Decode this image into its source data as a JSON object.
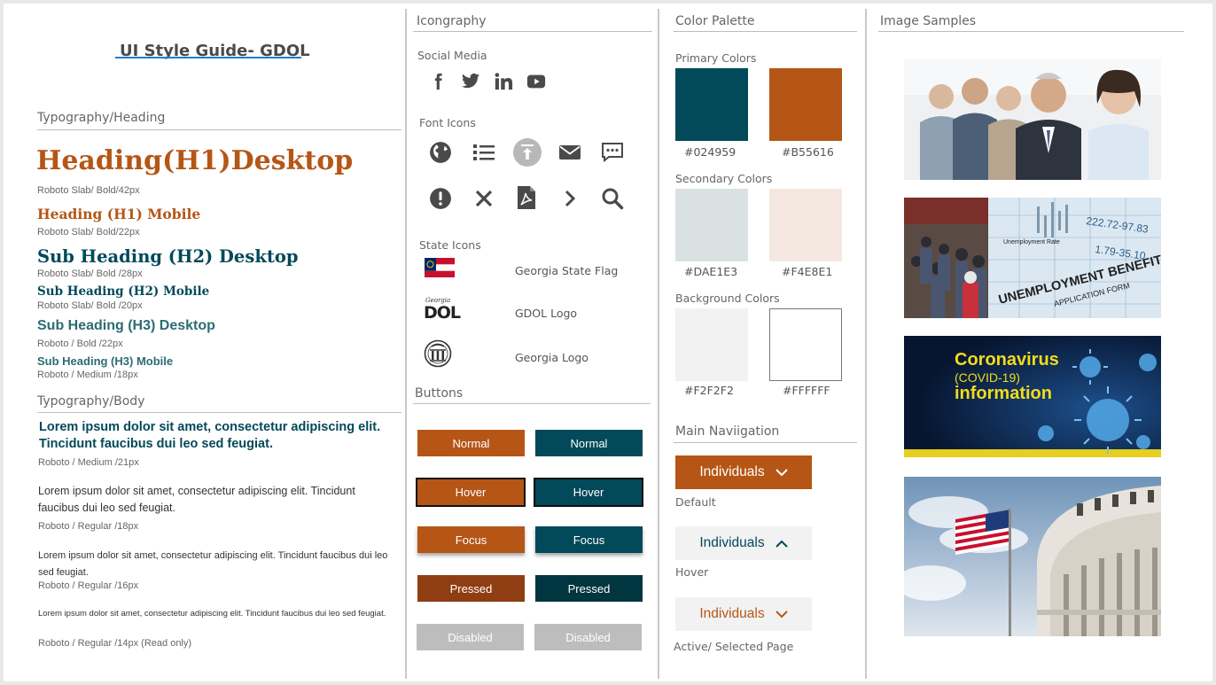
{
  "title": "UI Style Guide- GDOL",
  "colors": {
    "primary_teal": "#024959",
    "primary_orange": "#B55616",
    "secondary_gray": "#DAE1E3",
    "secondary_peach": "#F4E8E1",
    "bg_gray": "#F2F2F2",
    "bg_white": "#FFFFFF",
    "pressed_orange": "#8F3D12",
    "pressed_teal": "#01353F",
    "disabled": "#BDBDBD"
  },
  "typography": {
    "heading_section": "Typography/Heading",
    "items": [
      {
        "text": "Heading(H1)Desktop",
        "spec": "Roboto Slab/ Bold/42px"
      },
      {
        "text": "Heading (H1) Mobile",
        "spec": "Roboto Slab/ Bold/22px"
      },
      {
        "text": "Sub Heading (H2) Desktop",
        "spec": "Roboto Slab/ Bold /28px"
      },
      {
        "text": "Sub Heading (H2) Mobile",
        "spec": "Roboto Slab/ Bold /20px"
      },
      {
        "text": "Sub Heading (H3) Desktop",
        "spec": "Roboto / Bold /22px"
      },
      {
        "text": "Sub Heading (H3) Mobile",
        "spec": "Roboto / Medium /18px"
      }
    ],
    "body_section": "Typography/Body",
    "body": [
      {
        "text": "Lorem ipsum dolor sit amet, consectetur adipiscing elit. Tincidunt faucibus dui leo sed feugiat.",
        "spec": "Roboto / Medium /21px"
      },
      {
        "text": "Lorem ipsum dolor sit amet, consectetur adipiscing elit. Tincidunt faucibus dui leo sed feugiat.",
        "spec": "Roboto / Regular /18px"
      },
      {
        "text": "Lorem ipsum dolor sit amet, consectetur adipiscing elit. Tincidunt faucibus dui leo sed feugiat.",
        "spec": "Roboto / Regular /16px"
      },
      {
        "text": "Lorem ipsum dolor sit amet, consectetur adipiscing elit. Tincidunt faucibus dui leo sed feugiat.",
        "spec": "Roboto / Regular /14px (Read only)"
      }
    ]
  },
  "iconography": {
    "title": "Icongraphy",
    "social_title": "Social Media",
    "social_icons": [
      "facebook-icon",
      "twitter-icon",
      "linkedin-icon",
      "youtube-icon"
    ],
    "font_title": "Font Icons",
    "font_icons": [
      "globe-icon",
      "list-icon",
      "upload-icon",
      "mail-icon",
      "chat-icon",
      "alert-icon",
      "close-icon",
      "pdf-icon",
      "chevron-right-icon",
      "search-icon"
    ],
    "state_title": "State Icons",
    "state_icons": [
      {
        "icon": "georgia-flag-icon",
        "label": "Georgia State Flag"
      },
      {
        "icon": "gdol-logo-icon",
        "label": "GDOL Logo",
        "logo_text": "DOL",
        "logo_script": "Georgia"
      },
      {
        "icon": "georgia-seal-icon",
        "label": "Georgia Logo"
      }
    ]
  },
  "buttons": {
    "title": "Buttons",
    "rows": [
      {
        "state": "Normal",
        "label": "Normal"
      },
      {
        "state": "Hover",
        "label": "Hover"
      },
      {
        "state": "Focus",
        "label": "Focus"
      },
      {
        "state": "Pressed",
        "label": "Pressed"
      },
      {
        "state": "Disabled",
        "label": "Disabled"
      }
    ]
  },
  "palette": {
    "title": "Color Palette",
    "primary_title": "Primary Colors",
    "primary": [
      "#024959",
      "#B55616"
    ],
    "secondary_title": "Secondary Colors",
    "secondary": [
      "#DAE1E3",
      "#F4E8E1"
    ],
    "background_title": "Background Colors",
    "background": [
      "#F2F2F2",
      "#FFFFFF"
    ]
  },
  "navigation": {
    "title": "Main Naviigation",
    "items": [
      {
        "label": "Individuals",
        "state": "Default",
        "chevron": "down"
      },
      {
        "label": "Individuals",
        "state": "Hover",
        "chevron": "up"
      },
      {
        "label": "Individuals",
        "state": "Active/ Selected Page",
        "chevron": "down"
      }
    ]
  },
  "images": {
    "title": "Image Samples",
    "items": [
      {
        "name": "business-people-image"
      },
      {
        "name": "unemployment-benefits-image",
        "overlay": [
          "Unemployment Rate",
          "UNEMPLOYMENT BENEFITS",
          "APPLICATION FORM",
          "222.72-97.83",
          "1.79-35.10"
        ]
      },
      {
        "name": "coronavirus-banner-image",
        "overlay": [
          "Coronavirus",
          "(COVID-19)",
          "information"
        ]
      },
      {
        "name": "capitol-flag-image"
      }
    ]
  }
}
